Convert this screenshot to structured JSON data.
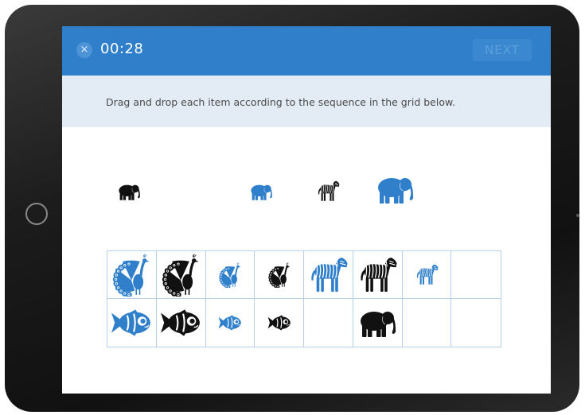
{
  "header": {
    "close_glyph": "×",
    "timer": "00:28",
    "next_label": "NEXT"
  },
  "instruction": "Drag and drop each item according to the sequence in the grid below.",
  "colors": {
    "brand_blue": "#2f7fcb",
    "item_blue": "#2f7fcb",
    "item_black": "#111111",
    "grid_line": "#b5d0e8",
    "instruction_bg": "#e3ecf5"
  },
  "sequence_items": [
    {
      "animal": "elephant-icon",
      "color": "black",
      "size": "small"
    },
    {
      "animal": "elephant-icon",
      "color": "blue",
      "size": "small"
    },
    {
      "animal": "zebra-icon",
      "color": "black",
      "size": "small"
    },
    {
      "animal": "elephant-icon",
      "color": "blue",
      "size": "large"
    }
  ],
  "grid": {
    "rows": [
      [
        {
          "animal": "peacock-icon",
          "color": "blue",
          "size": "large"
        },
        {
          "animal": "peacock-icon",
          "color": "black",
          "size": "large"
        },
        {
          "animal": "peacock-icon",
          "color": "blue",
          "size": "small"
        },
        {
          "animal": "peacock-icon",
          "color": "black",
          "size": "small"
        },
        {
          "animal": "zebra-icon",
          "color": "blue",
          "size": "large"
        },
        {
          "animal": "zebra-icon",
          "color": "black",
          "size": "large"
        },
        {
          "animal": "zebra-icon",
          "color": "blue",
          "size": "small"
        },
        null
      ],
      [
        {
          "animal": "fish-icon",
          "color": "blue",
          "size": "large"
        },
        {
          "animal": "fish-icon",
          "color": "black",
          "size": "large"
        },
        {
          "animal": "fish-icon",
          "color": "blue",
          "size": "small"
        },
        {
          "animal": "fish-icon",
          "color": "black",
          "size": "small"
        },
        null,
        {
          "animal": "elephant-icon",
          "color": "black",
          "size": "large"
        },
        null,
        null
      ]
    ]
  }
}
